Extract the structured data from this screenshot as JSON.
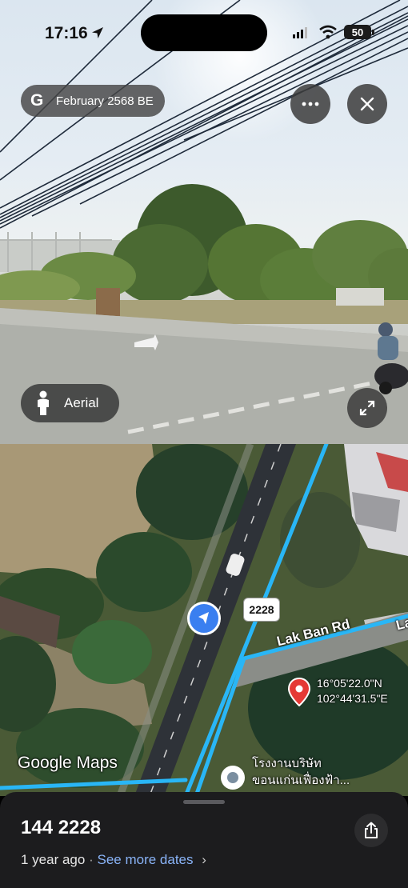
{
  "status_bar": {
    "time": "17:16",
    "battery": "50",
    "icons": [
      "location-arrow-icon",
      "signal-icon",
      "wifi-icon",
      "battery-icon"
    ]
  },
  "street_view": {
    "capture_date": "February 2568 BE",
    "logo_letter": "G",
    "aerial_label": "Aerial",
    "buttons": [
      "more-icon",
      "close-icon",
      "expand-icon",
      "person-icon"
    ]
  },
  "map": {
    "route_badge": "2228",
    "road_label": "Lak Ban Rd",
    "road_label_partial": "La",
    "coordinates": {
      "lat": "16°05'22.0\"N",
      "lng": "102°44'31.5\"E"
    },
    "wordmark": "Google Maps",
    "poi": {
      "line1": "โรงงานบริษัท",
      "line2": "ขอนแก่นเฟื่องฟ้า..."
    },
    "colors": {
      "street_view_lines": "#29b6f6",
      "pin": "#e53935",
      "nav_arrow": "#3a7ff0"
    }
  },
  "sheet": {
    "title": "144 2228",
    "age": "1 year ago",
    "separator": "·",
    "more_dates": "See more dates",
    "chevron": "›",
    "link_color": "#8ab4f8"
  }
}
